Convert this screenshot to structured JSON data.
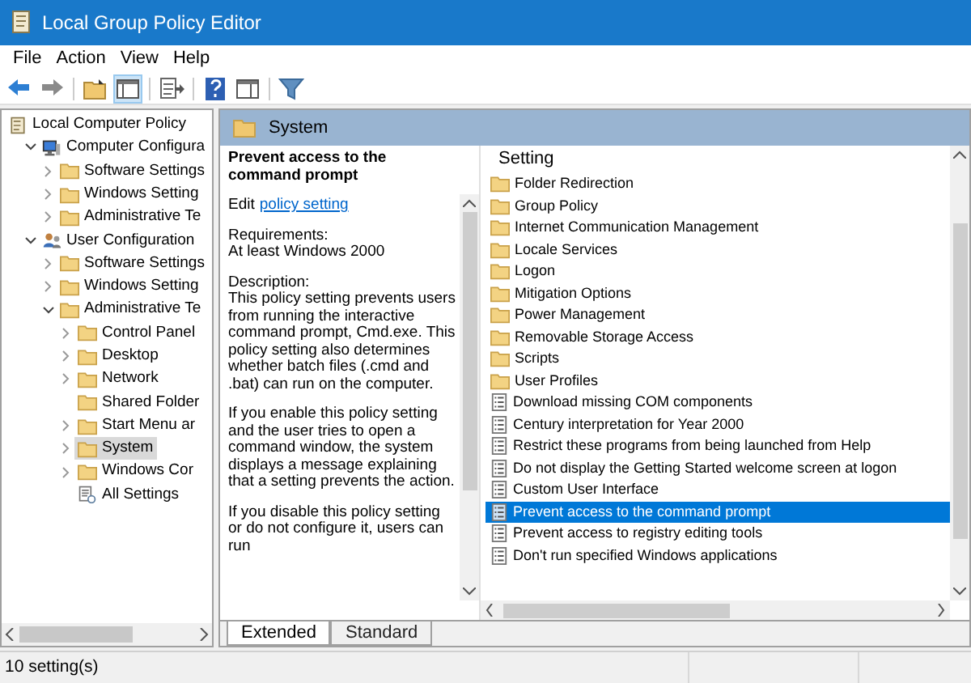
{
  "window": {
    "title": "Local Group Policy Editor"
  },
  "menu": [
    "File",
    "Action",
    "View",
    "Help"
  ],
  "toolbar": [
    {
      "kind": "back",
      "pressed": false
    },
    {
      "kind": "forward",
      "pressed": false
    },
    {
      "kind": "sep"
    },
    {
      "kind": "up",
      "pressed": false
    },
    {
      "kind": "tree",
      "pressed": true
    },
    {
      "kind": "sep"
    },
    {
      "kind": "export",
      "pressed": false
    },
    {
      "kind": "sep"
    },
    {
      "kind": "help",
      "pressed": false
    },
    {
      "kind": "pane",
      "pressed": false
    },
    {
      "kind": "sep"
    },
    {
      "kind": "filter",
      "pressed": false
    }
  ],
  "tree": [
    {
      "label": "Local Computer Policy",
      "kind": "policy",
      "selected": false,
      "children": [
        {
          "label": "Computer Configura",
          "kind": "computer",
          "expanded": true,
          "selected": false,
          "children": [
            {
              "label": "Software Settings",
              "kind": "folder",
              "expanded": false,
              "selected": false
            },
            {
              "label": "Windows Setting",
              "kind": "folder",
              "expanded": false,
              "selected": false
            },
            {
              "label": "Administrative Te",
              "kind": "folder",
              "expanded": false,
              "selected": false
            }
          ]
        },
        {
          "label": "User Configuration",
          "kind": "user",
          "expanded": true,
          "selected": false,
          "children": [
            {
              "label": "Software Settings",
              "kind": "folder",
              "expanded": false,
              "selected": false
            },
            {
              "label": "Windows Setting",
              "kind": "folder",
              "expanded": false,
              "selected": false
            },
            {
              "label": "Administrative Te",
              "kind": "folder",
              "expanded": true,
              "selected": false,
              "children": [
                {
                  "label": "Control Panel",
                  "kind": "folder",
                  "expanded": false,
                  "selected": false
                },
                {
                  "label": "Desktop",
                  "kind": "folder",
                  "expanded": false,
                  "selected": false
                },
                {
                  "label": "Network",
                  "kind": "folder",
                  "expanded": false,
                  "selected": false
                },
                {
                  "label": "Shared Folder",
                  "kind": "folder",
                  "selected": false
                },
                {
                  "label": "Start Menu ar",
                  "kind": "folder",
                  "expanded": false,
                  "selected": false
                },
                {
                  "label": "System",
                  "kind": "folder",
                  "expanded": false,
                  "selected": true
                },
                {
                  "label": "Windows Cor",
                  "kind": "folder",
                  "expanded": false,
                  "selected": false
                },
                {
                  "label": "All Settings",
                  "kind": "all",
                  "selected": false
                }
              ]
            }
          ]
        }
      ]
    }
  ],
  "header": {
    "title": "System"
  },
  "description": {
    "title": "Prevent access to the command prompt",
    "edit_prefix": "Edit",
    "edit_link": "policy setting",
    "paragraphs": [
      "Requirements:\nAt least Windows 2000",
      "Description:\nThis policy setting prevents users from running the interactive command prompt, Cmd.exe.  This policy setting also determines whether batch files (.cmd and .bat) can run on the computer.",
      "If you enable this policy setting and the user tries to open a command window, the system displays a message explaining that a setting prevents the action.",
      "If you disable this policy setting or do not configure it, users can run"
    ]
  },
  "list": {
    "column": "Setting",
    "items": [
      {
        "label": "Folder Redirection",
        "kind": "folder",
        "selected": false
      },
      {
        "label": "Group Policy",
        "kind": "folder",
        "selected": false
      },
      {
        "label": "Internet Communication Management",
        "kind": "folder",
        "selected": false
      },
      {
        "label": "Locale Services",
        "kind": "folder",
        "selected": false
      },
      {
        "label": "Logon",
        "kind": "folder",
        "selected": false
      },
      {
        "label": "Mitigation Options",
        "kind": "folder",
        "selected": false
      },
      {
        "label": "Power Management",
        "kind": "folder",
        "selected": false
      },
      {
        "label": "Removable Storage Access",
        "kind": "folder",
        "selected": false
      },
      {
        "label": "Scripts",
        "kind": "folder",
        "selected": false
      },
      {
        "label": "User Profiles",
        "kind": "folder",
        "selected": false
      },
      {
        "label": "Download missing COM components",
        "kind": "setting",
        "selected": false
      },
      {
        "label": "Century interpretation for Year 2000",
        "kind": "setting",
        "selected": false
      },
      {
        "label": "Restrict these programs from being launched from Help",
        "kind": "setting",
        "selected": false
      },
      {
        "label": "Do not display the Getting Started welcome screen at logon",
        "kind": "setting",
        "selected": false
      },
      {
        "label": "Custom User Interface",
        "kind": "setting",
        "selected": false
      },
      {
        "label": "Prevent access to the command prompt",
        "kind": "setting",
        "selected": true
      },
      {
        "label": "Prevent access to registry editing tools",
        "kind": "setting",
        "selected": false
      },
      {
        "label": "Don't run specified Windows applications",
        "kind": "setting",
        "selected": false
      }
    ]
  },
  "tabs": [
    {
      "label": "Extended",
      "selected": true
    },
    {
      "label": "Standard",
      "selected": false
    }
  ],
  "status_bar": {
    "text": "10 setting(s)"
  }
}
